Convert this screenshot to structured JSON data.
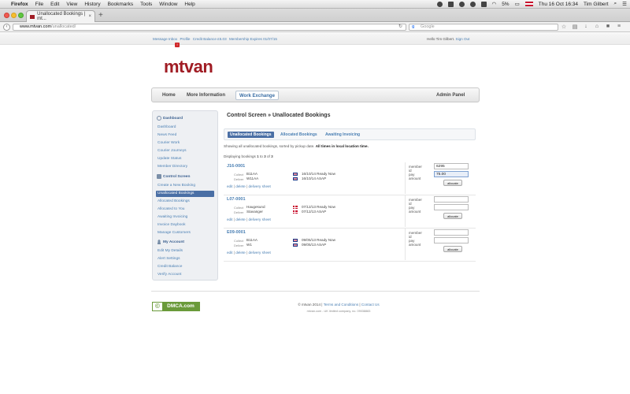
{
  "os_menubar": {
    "app": "Firefox",
    "menus": [
      "File",
      "Edit",
      "View",
      "History",
      "Bookmarks",
      "Tools",
      "Window",
      "Help"
    ],
    "battery": "5%",
    "clock": "Thu 16 Oct  16:34",
    "user": "Tim Gilbert"
  },
  "browser": {
    "tab_title": "Unallocated Bookings | mt...",
    "url_host": "www.mtvan.com",
    "url_path": "/unallocated/",
    "search_placeholder": "Google"
  },
  "top_strip": {
    "links": [
      "Message Inbox",
      "Profile",
      "Credit Balance £5.03",
      "Membership Expires 01/07/15"
    ],
    "greeting": "Hello Tim Gilbert.",
    "sign_out": "Sign Out"
  },
  "logo": "mtvan",
  "main_nav": {
    "home": "Home",
    "more_info": "More Information",
    "work_exchange": "Work Exchange",
    "admin_panel": "Admin Panel"
  },
  "sidebar": {
    "dashboard": {
      "heading": "Dashboard",
      "items": [
        "Dashboard",
        "News Feed",
        "Courier Work",
        "Courier Journeys",
        "Update Status",
        "Member Directory"
      ]
    },
    "control": {
      "heading": "Control Screen",
      "items": [
        "Create a New Booking",
        "Unallocated Bookings",
        "Allocated Bookings",
        "Allocated to You",
        "Awaiting Invoicing",
        "Invoice Daybook",
        "Manage Customers"
      ]
    },
    "account": {
      "heading": "My Account",
      "items": [
        "Edit My Details",
        "Alert Settings",
        "Credit Balance",
        "Verify Account"
      ]
    }
  },
  "content": {
    "title": "Control Screen » Unallocated Bookings",
    "tabs": [
      "Unallocated Bookings",
      "Allocated Bookings",
      "Awaiting Invoicing"
    ],
    "info_text": "Showing all unallocated bookings, sorted by pickup date.",
    "info_bold": "All times in local location time.",
    "count_prefix": "Displaying bookings",
    "count_from": "1",
    "count_to_word": "to",
    "count_to": "3",
    "count_of_word": "of",
    "count_total": "3",
    "labels": {
      "collect": "Collect",
      "deliver": "Deliver",
      "member_id": "member id",
      "pay_amount": "pay amount",
      "allocate": "allocate",
      "edit": "edit",
      "delete": "delete",
      "delivery_sheet": "delivery sheet",
      "sep": "|"
    },
    "bookings": [
      {
        "ref": "J16-0001",
        "collect": "B11AA",
        "deliver": "W11AA",
        "collect_date": "16/10/14 Ready Now",
        "deliver_date": "16/10/14 ASAP",
        "collect_flag": "uk",
        "deliver_flag": "uk",
        "member_id": "6295",
        "pay_amount": "75.00"
      },
      {
        "ref": "L07-0001",
        "collect": "Haugesund",
        "deliver": "Stavanger",
        "collect_date": "07/12/13 Ready Now",
        "deliver_date": "07/12/13 ASAP",
        "collect_flag": "no",
        "deliver_flag": "no",
        "member_id": "",
        "pay_amount": ""
      },
      {
        "ref": "E09-0001",
        "collect": "B11AA",
        "deliver": "W1",
        "collect_date": "09/05/13 Ready Now",
        "deliver_date": "09/05/13 ASAP",
        "collect_flag": "uk",
        "deliver_flag": "uk",
        "member_id": "",
        "pay_amount": ""
      }
    ]
  },
  "footer": {
    "dmca": "DMCA.com",
    "copyright": "© mtvan 2014",
    "terms": "Terms and Conditions",
    "contact": "Contact Us",
    "company": "mtvan.com - UK limited company, no. 09038883"
  },
  "colors": {
    "brand": "#a01c24",
    "link": "#4a7fb3",
    "active": "#4a6fa5"
  }
}
